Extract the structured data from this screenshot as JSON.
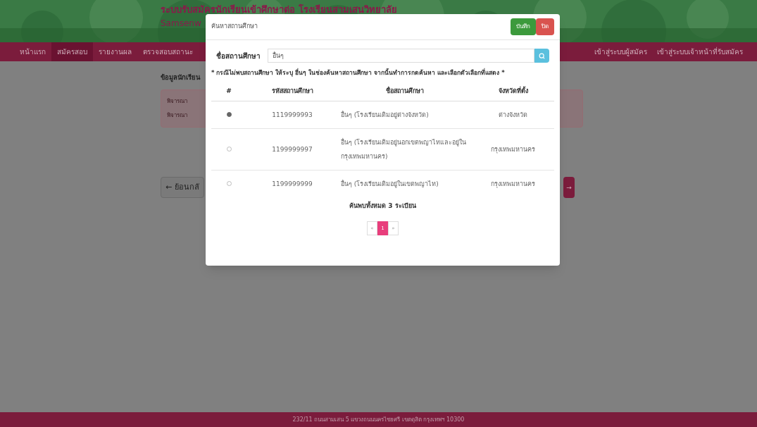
{
  "header": {
    "title": "ระบบรับสมัครนักเรียนเข้าศึกษาต่อ โรงเรียนสามเสนวิทยาลัย",
    "subtitle": "Samsenw"
  },
  "nav": {
    "items": [
      {
        "label": "หน้าแรก",
        "selected": false
      },
      {
        "label": "สมัครสอบ",
        "selected": true
      },
      {
        "label": "รายงานผล",
        "selected": false
      },
      {
        "label": "ตรวจสอบสถานะ",
        "selected": false
      }
    ],
    "right_items": [
      "เข้าสู่ระบบผู้สมัคร",
      "เข้าสู่ระบบเจ้าหน้าที่รับสมัคร"
    ]
  },
  "page": {
    "section_title": "ข้อมูลนักเรียน",
    "alert_lines": [
      "พิจารณา",
      "พิจารณา"
    ],
    "back_button": "← ย้อนกลั",
    "next_button": "→"
  },
  "modal": {
    "title": "ค้นหาสถานศึกษา",
    "buttons": [
      {
        "label": "บันทึก",
        "kind": "save"
      },
      {
        "label": "ปิด",
        "kind": "close"
      }
    ],
    "search": {
      "label": "ชื่อสถานศึกษา",
      "value": "อื่นๆ"
    },
    "note": "* กรณีไม่พบสถานศึกษา ให้ระบุ อื่นๆ ในช่องค้นหาสถานศึกษา จากนั้นทำการกดค้นหา และเลือกตัวเลือกที่แสดง *",
    "table": {
      "columns": [
        "#",
        "รหัสสถานศึกษา",
        "ชื่อสถานศึกษา",
        "จังหวัดที่ตั้ง"
      ],
      "rows": [
        {
          "selected": true,
          "code": "1119999993",
          "name": "อื่นๆ (โรงเรียนเดิมอยู่ต่างจังหวัด)",
          "province": "ต่างจังหวัด"
        },
        {
          "selected": false,
          "code": "1199999997",
          "name": "อื่นๆ (โรงเรียนเดิมอยู่นอกเขตพญาไทและอยู่ในกรุงเทพมหานคร)",
          "province": "กรุงเทพมหานคร"
        },
        {
          "selected": false,
          "code": "1199999999",
          "name": "อื่นๆ (โรงเรียนเดิมอยู่ในเขตพญาไท)",
          "province": "กรุงเทพมหานคร"
        }
      ]
    },
    "count": "ค้นพบทั้งหมด 3 ระเบียน",
    "pagination": [
      {
        "label": "«",
        "selected": false
      },
      {
        "label": "1",
        "selected": true
      },
      {
        "label": "»",
        "selected": false
      }
    ]
  },
  "footer": "232/11 ถนนสามเสน 5 แขวงถนนนครไชยศรี เขตดุสิต กรุงเทพฯ 10300"
}
